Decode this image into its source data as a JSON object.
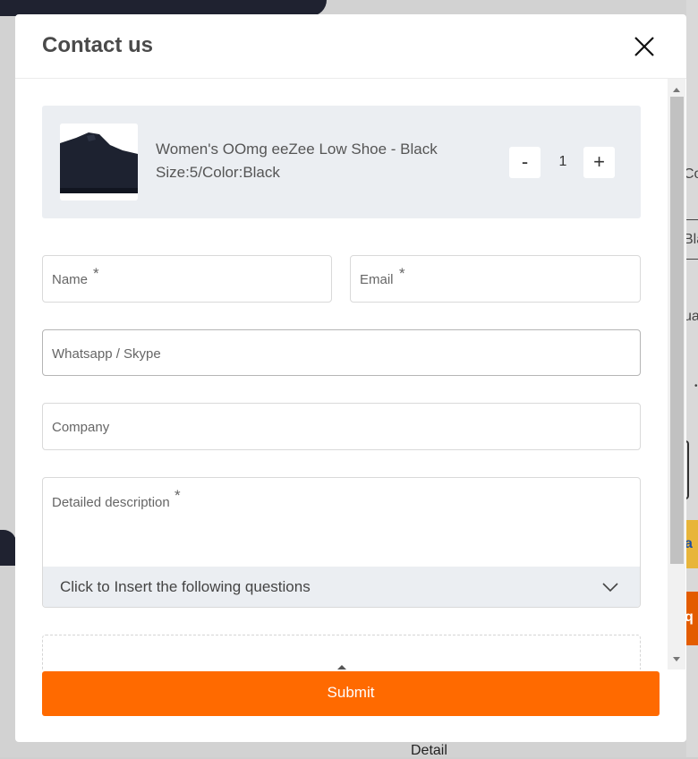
{
  "modal": {
    "title": "Contact us"
  },
  "product": {
    "name": "Women's OOmg eeZee Low Shoe - Black",
    "variant": "Size:5/Color:Black",
    "quantity": "1",
    "minus_label": "-",
    "plus_label": "+"
  },
  "form": {
    "name_label": "Name",
    "email_label": "Email",
    "whatsapp_label": "Whatsapp / Skype",
    "company_label": "Company",
    "description_label": "Detailed description",
    "required_mark": "*",
    "insert_questions_label": "Click to Insert the following questions"
  },
  "submit_label": "Submit",
  "background": {
    "label_co": "Co",
    "label_bla": "Bla",
    "label_ua": "ua",
    "yellow_text": "a",
    "orange_text": "q",
    "detail_label": "Detail"
  },
  "colors": {
    "accent": "#ff6a00",
    "card_bg": "#ebeef2"
  },
  "icons": {
    "close": "close-icon",
    "chevron": "chevron-down-icon",
    "upload": "upload-arrow-icon"
  }
}
